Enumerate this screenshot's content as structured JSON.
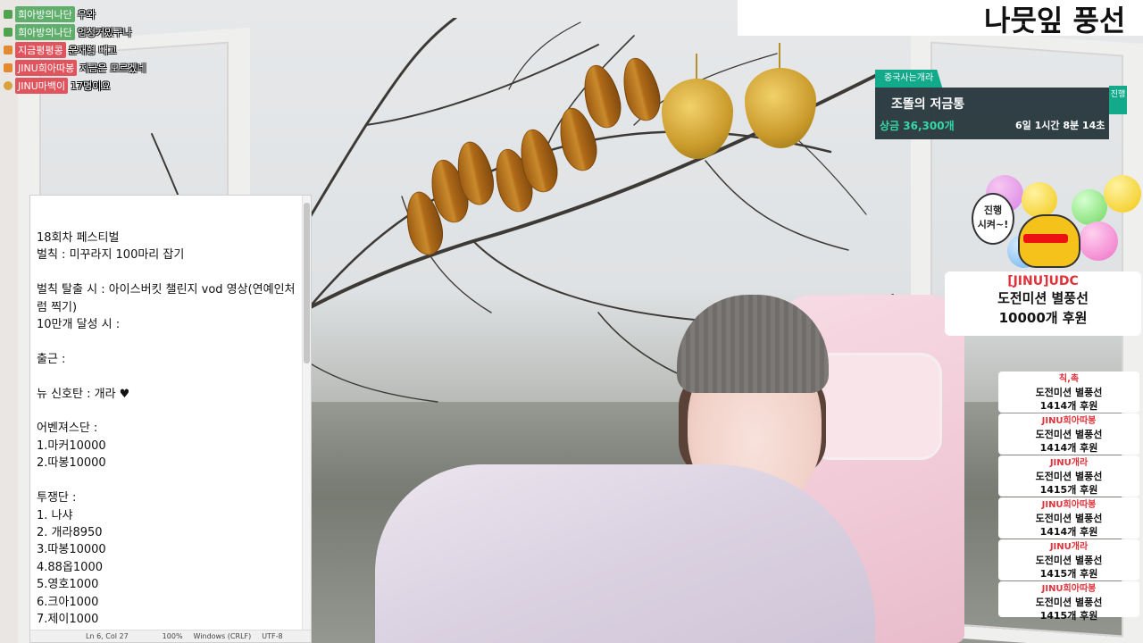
{
  "chat": [
    {
      "badge": "M",
      "name": "희아방의나단",
      "name_style": "green",
      "message": "우와"
    },
    {
      "badge": "M",
      "name": "희아방의나단",
      "name_style": "green",
      "message": "엄청커있구나"
    },
    {
      "badge": "F",
      "name": "지금평평콩",
      "name_style": "red",
      "message": "운재형 빼고"
    },
    {
      "badge": "F",
      "name": "JINU희아따봉",
      "name_style": "red",
      "message": "지금은 모르겠네"
    },
    {
      "badge": "F",
      "name": "JINU마백이",
      "name_style": "red",
      "message": "17명이요"
    }
  ],
  "banner": {
    "text": "나뭇잎 풍선"
  },
  "challenge": {
    "tag": "중국사는개라",
    "title": "조똘의 저금통",
    "prize": "상금 36,300개",
    "time": "6일 1시간  8분 14초",
    "status": "진행"
  },
  "mascot": {
    "speech": "진행\n시켜~!"
  },
  "donation_popup": {
    "name": "[JINU]UDC",
    "line1": "도전미션 별풍선",
    "line2": "10000개 후원"
  },
  "donation_list": [
    {
      "name": "칙,촉",
      "line1": "도전미션 별풍선",
      "line2": "1414개 후원"
    },
    {
      "name": "JINU희아따봉",
      "line1": "도전미션 별풍선",
      "line2": "1414개 후원"
    },
    {
      "name": "JINU개라",
      "line1": "도전미션 별풍선",
      "line2": "1415개 후원"
    },
    {
      "name": "JINU희아따봉",
      "line1": "도전미션 별풍선",
      "line2": "1414개 후원"
    },
    {
      "name": "JINU개라",
      "line1": "도전미션 별풍선",
      "line2": "1415개 후원"
    },
    {
      "name": "JINU희아따봉",
      "line1": "도전미션 별풍선",
      "line2": "1415개 후원"
    }
  ],
  "notepad": {
    "lines": "18회차 페스티벌\n벌칙 : 미꾸라지 100마리 잡기\n\n벌칙 탈출 시 : 아이스버킷 챌린지 vod 영상(연예인처럼 찍기)\n10만개 달성 시 :\n\n출근 :\n\n뉴 신호탄 : 개라 ♥\n\n어벤져스단 :\n1.마커10000\n2.따봉10000\n\n투쟁단 :\n1. 나샤\n2. 개라8950\n3.따봉10000\n4.88옵1000\n5.영호1000\n6.크아1000\n7.제이1000",
    "status_position": "Ln 6, Col 27",
    "status_zoom": "100%",
    "status_eol": "Windows (CRLF)",
    "status_encoding": "UTF-8"
  }
}
